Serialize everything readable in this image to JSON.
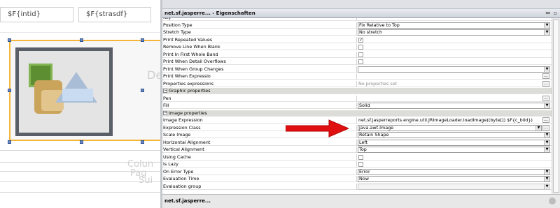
{
  "canvas": {
    "field_1": "$F{intid}",
    "field_2": "$F{strasdf}",
    "ghost_text_1": "De",
    "ghost_text_2": "Colun",
    "ghost_text_3": "Pag",
    "ghost_text_4": "Sui"
  },
  "panel": {
    "title": "net.sf.jasperre... - Eigenschaften",
    "status": "net.sf.jasperre...",
    "colors": {
      "highlight": "#f3b53a",
      "arrow": "#e01010",
      "category": "#dcdcd8"
    }
  },
  "rows": [
    {
      "name": "Key",
      "kind": "text",
      "value": ""
    },
    {
      "name": "Position Type",
      "kind": "combo",
      "value": "Fix Relative to Top"
    },
    {
      "name": "Stretch Type",
      "kind": "combo",
      "value": "No stretch"
    },
    {
      "name": "Print Repeated Values",
      "kind": "check",
      "checked": true
    },
    {
      "name": "Remove Line When Blank",
      "kind": "check",
      "checked": false
    },
    {
      "name": "Print In First Whole Band",
      "kind": "check",
      "checked": false
    },
    {
      "name": "Print When Detail Overflows",
      "kind": "check",
      "checked": false
    },
    {
      "name": "Print When Group Changes",
      "kind": "combo",
      "value": ""
    },
    {
      "name": "Print When Expressio",
      "kind": "dots",
      "value": ""
    },
    {
      "name": "Properties expressions",
      "kind": "dots-gray",
      "value": "No properties set"
    },
    {
      "name": "Graphic properties",
      "kind": "category"
    },
    {
      "name": "Pen",
      "kind": "dots",
      "value": ""
    },
    {
      "name": "Fill",
      "kind": "combo",
      "value": "Solid"
    },
    {
      "name": "Image properties",
      "kind": "category"
    },
    {
      "name": "Image Expression",
      "kind": "dots",
      "value": "net.sf.jasperreports.engine.util.JRImageLoader.loadImage((byte[]) $F{c_bild})"
    },
    {
      "name": "Expression Class",
      "kind": "combo-dots",
      "value": "java.awt.Image"
    },
    {
      "name": "Scale Image",
      "kind": "combo",
      "value": "Retain Shape"
    },
    {
      "name": "Horizontal Alignment",
      "kind": "combo",
      "value": "Left"
    },
    {
      "name": "Vertical Alignment",
      "kind": "combo",
      "value": "Top"
    },
    {
      "name": "Using Cache",
      "kind": "check",
      "checked": false
    },
    {
      "name": "Is Lazy",
      "kind": "check",
      "checked": false
    },
    {
      "name": "On Error Type",
      "kind": "combo",
      "value": "Error"
    },
    {
      "name": "Evaluation Time",
      "kind": "combo",
      "value": "Now"
    },
    {
      "name": "Evaluation group",
      "kind": "combo-disabled",
      "value": ""
    }
  ]
}
